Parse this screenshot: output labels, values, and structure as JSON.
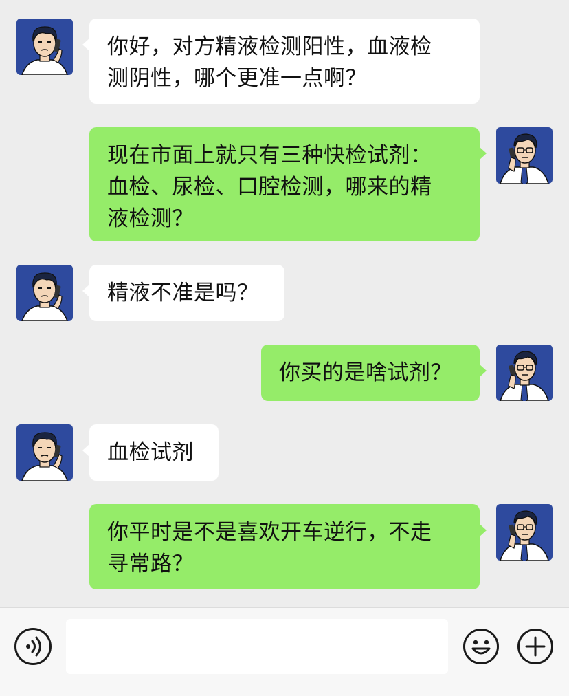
{
  "messages": [
    {
      "side": "left",
      "sender": "patient",
      "text": "你好，对方精液检测阳性，血液检\n测阴性，哪个更准一点啊？"
    },
    {
      "side": "right",
      "sender": "doctor",
      "text": "现在市面上就只有三种快检试剂：\n血检、尿检、口腔检测，哪来的精\n液检测？"
    },
    {
      "side": "left",
      "sender": "patient",
      "text": "精液不准是吗？"
    },
    {
      "side": "right",
      "sender": "doctor",
      "text": "你买的是啥试剂？"
    },
    {
      "side": "left",
      "sender": "patient",
      "text": "血检试剂"
    },
    {
      "side": "right",
      "sender": "doctor",
      "text": "你平时是不是喜欢开车逆行，不走\n寻常路？"
    }
  ],
  "input_bar": {
    "text_value": "",
    "icons": [
      "voice-icon",
      "emoji-icon",
      "plus-icon"
    ]
  },
  "colors": {
    "background": "#ededed",
    "bubble_left": "#ffffff",
    "bubble_right": "#95ec69",
    "avatar_bg": "#2e4a9e"
  }
}
